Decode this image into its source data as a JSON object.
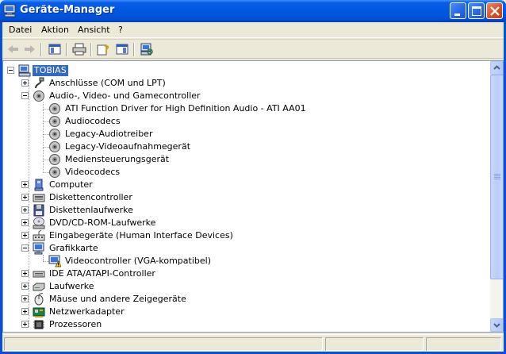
{
  "window": {
    "title": "Geräte-Manager",
    "icon": "computer-monitor-icon",
    "controls": [
      "minimize-icon",
      "maximize-icon",
      "close-icon"
    ]
  },
  "menu": {
    "items": [
      "Datei",
      "Aktion",
      "Ansicht",
      "?"
    ]
  },
  "toolbar": {
    "buttons": [
      "back-arrow-icon",
      "forward-arrow-icon",
      "console-tree-icon",
      "print-icon",
      "properties-help-icon",
      "show-pane-icon",
      "scan-hardware-icon"
    ]
  },
  "tree": {
    "root": "TOBIAS",
    "items": [
      {
        "label": "Anschlüsse (COM und LPT)",
        "icon": "port-icon",
        "expanded": false
      },
      {
        "label": "Audio-, Video- und Gamecontroller",
        "icon": "sound-icon",
        "expanded": true,
        "children": [
          "ATI Function Driver for High Definition Audio - ATI AA01",
          "Audiocodecs",
          "Legacy-Audiotreiber",
          "Legacy-Videoaufnahmegerät",
          "Mediensteuerungsgerät",
          "Videocodecs"
        ]
      },
      {
        "label": "Computer",
        "icon": "computer-icon",
        "expanded": false
      },
      {
        "label": "Diskettencontroller",
        "icon": "floppy-controller-icon",
        "expanded": false
      },
      {
        "label": "Diskettenlaufwerke",
        "icon": "floppy-drive-icon",
        "expanded": false
      },
      {
        "label": "DVD/CD-ROM-Laufwerke",
        "icon": "cd-drive-icon",
        "expanded": false
      },
      {
        "label": "Eingabegeräte (Human Interface Devices)",
        "icon": "hid-icon",
        "expanded": false
      },
      {
        "label": "Grafikkarte",
        "icon": "display-adapter-icon",
        "expanded": true,
        "children": [
          "Videocontroller (VGA-kompatibel)"
        ]
      },
      {
        "label": "IDE ATA/ATAPI-Controller",
        "icon": "ide-controller-icon",
        "expanded": false
      },
      {
        "label": "Laufwerke",
        "icon": "disk-drive-icon",
        "expanded": false
      },
      {
        "label": "Mäuse und andere Zeigegeräte",
        "icon": "mouse-icon",
        "expanded": false
      },
      {
        "label": "Netzwerkadapter",
        "icon": "network-adapter-icon",
        "expanded": false
      },
      {
        "label": "Prozessoren",
        "icon": "processor-icon",
        "expanded": false
      }
    ]
  },
  "colors": {
    "titlebar": "#0058E0",
    "selection": "#316AC5",
    "window_bg": "#ECE9D8"
  }
}
